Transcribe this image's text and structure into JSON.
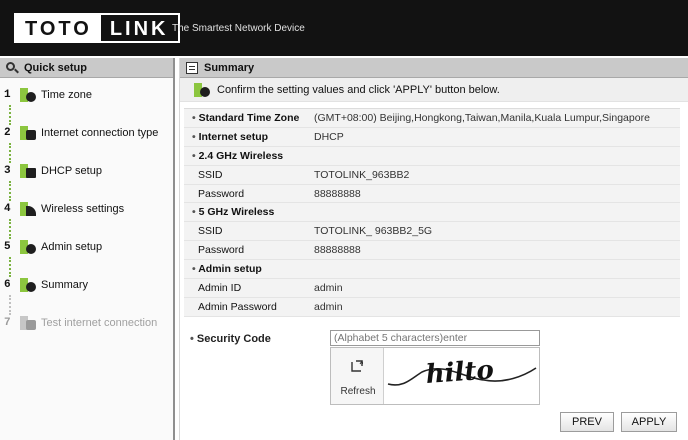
{
  "header": {
    "logo_left": "TOTO",
    "logo_right": "LINK",
    "tagline": "The Smartest Network Device"
  },
  "sidebar": {
    "title": "Quick setup",
    "steps": [
      {
        "num": "1",
        "label": "Time zone",
        "icon": "clock-icon"
      },
      {
        "num": "2",
        "label": "Internet connection type",
        "icon": "network-icon"
      },
      {
        "num": "3",
        "label": "DHCP setup",
        "icon": "dhcp-icon"
      },
      {
        "num": "4",
        "label": "Wireless settings",
        "icon": "wireless-icon"
      },
      {
        "num": "5",
        "label": "Admin setup",
        "icon": "admin-icon"
      },
      {
        "num": "6",
        "label": "Summary",
        "icon": "summary-icon"
      },
      {
        "num": "7",
        "label": "Test internet connection",
        "icon": "test-icon"
      }
    ]
  },
  "main": {
    "title": "Summary",
    "instruction": "Confirm the setting values and click 'APPLY' button below.",
    "rows": [
      {
        "key": "Standard Time Zone",
        "value": "(GMT+08:00) Beijing,Hongkong,Taiwan,Manila,Kuala Lumpur,Singapore"
      },
      {
        "key": "Internet setup",
        "value": "DHCP"
      },
      {
        "key": "2.4 GHz Wireless",
        "value": ""
      },
      {
        "key": "SSID",
        "value": "TOTOLINK_963BB2"
      },
      {
        "key": "Password",
        "value": "88888888"
      },
      {
        "key": "5 GHz Wireless",
        "value": ""
      },
      {
        "key": "SSID",
        "value": "TOTOLINK_ 963BB2_5G"
      },
      {
        "key": "Password",
        "value": "88888888"
      },
      {
        "key": "Admin setup",
        "value": ""
      },
      {
        "key": "Admin ID",
        "value": "admin"
      },
      {
        "key": "Admin Password",
        "value": "admin"
      }
    ],
    "security": {
      "label": "Security Code",
      "placeholder": "(Alphabet 5 characters)enter",
      "refresh_label": "Refresh",
      "captcha_text": "hilto"
    },
    "buttons": {
      "prev": "PREV",
      "apply": "APPLY"
    }
  },
  "colors": {
    "header_bg": "#121212",
    "accent_green": "#8cc63f",
    "panel_head_bg": "#c9c9c9"
  }
}
